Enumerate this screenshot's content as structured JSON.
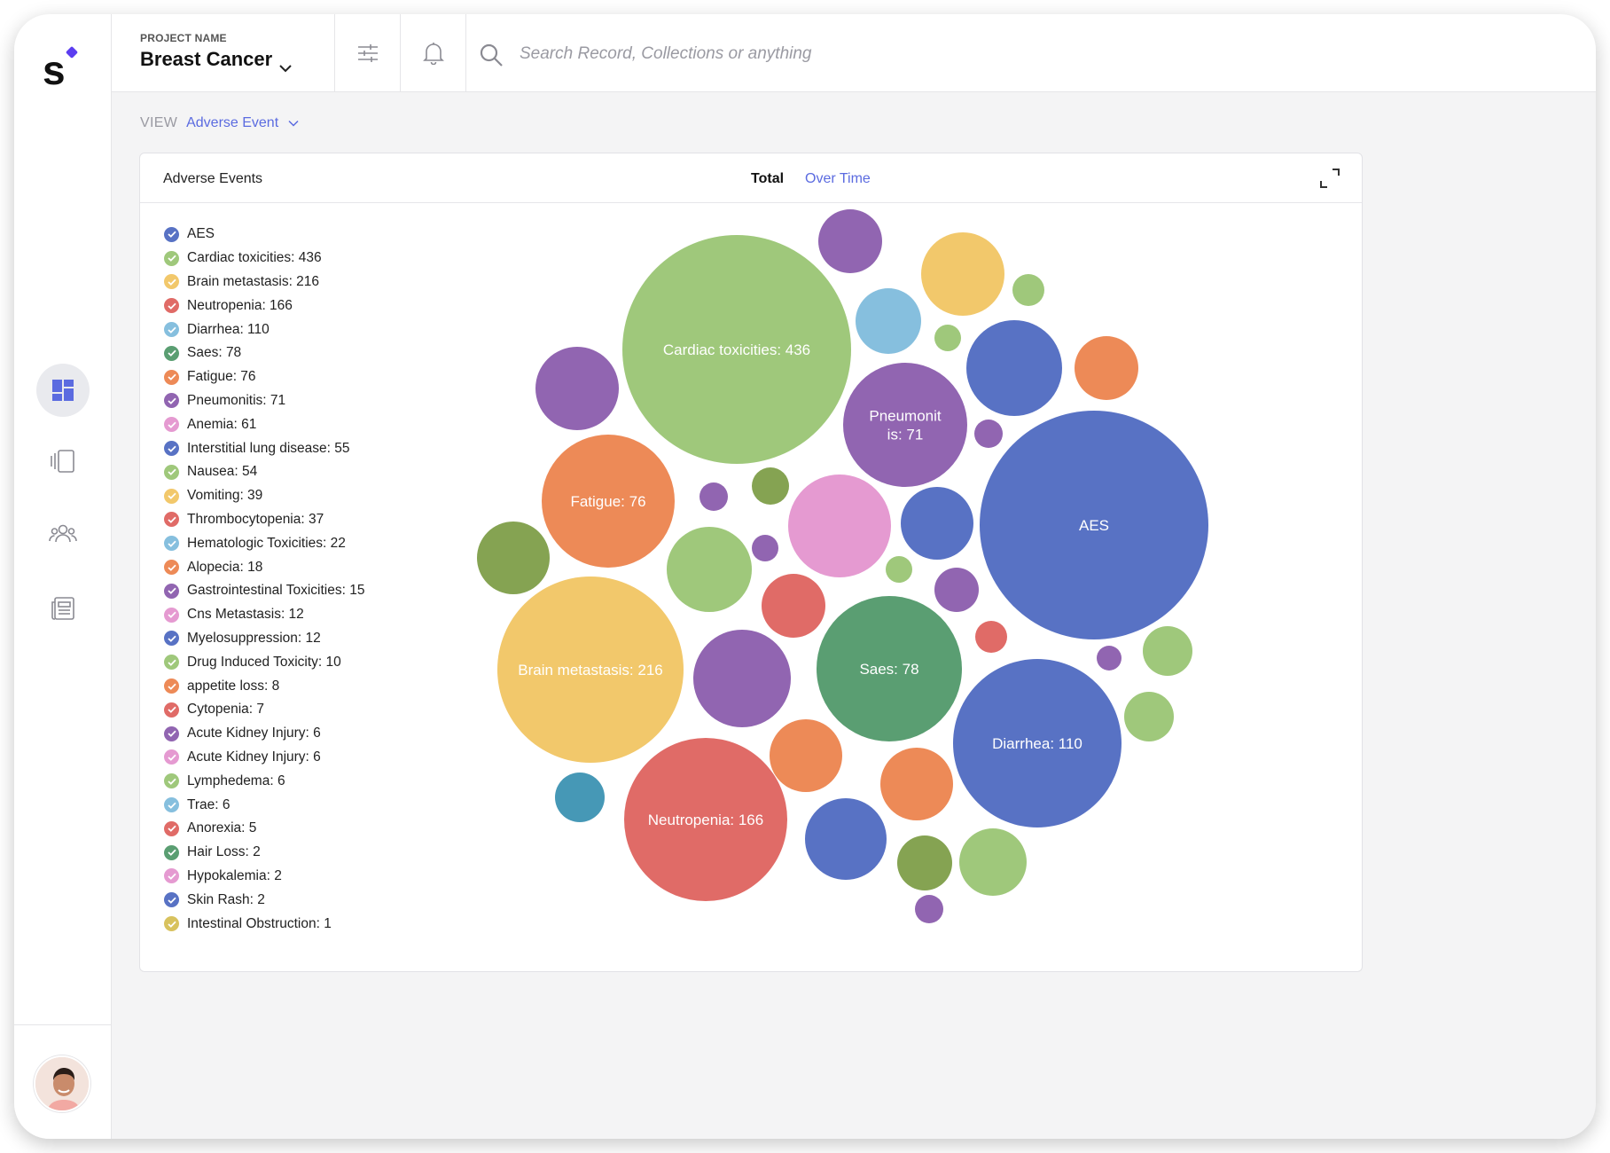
{
  "app": {
    "logo_text": "s"
  },
  "header": {
    "project_label": "PROJECT NAME",
    "project_name": "Breast Cancer",
    "search_placeholder": "Search Record, Collections or anything"
  },
  "view": {
    "label": "VIEW",
    "value": "Adverse Event"
  },
  "panel": {
    "title": "Adverse Events",
    "tabs": {
      "total": "Total",
      "over_time": "Over Time"
    },
    "active_tab": "Total"
  },
  "icons": {
    "sidebar": [
      "dashboard-icon",
      "collections-icon",
      "users-icon",
      "news-icon"
    ],
    "topbar": [
      "chevron-down-icon",
      "filter-sliders-icon",
      "bell-icon",
      "search-icon"
    ],
    "panel": [
      "expand-icon"
    ]
  },
  "colors": {
    "accent": "#5b6be0",
    "blue": "#5872c4",
    "green": "#9fc87b",
    "yellow": "#f2c86b",
    "red": "#e06b67",
    "lightblue": "#86bfde",
    "darkgreen": "#5a9e72",
    "orange": "#ed8a57",
    "purple": "#9165b1",
    "pink": "#e59ad1",
    "olive": "#85a352",
    "teal": "#4698b6",
    "mustard": "#d8c25e"
  },
  "legend": [
    {
      "label": "AES",
      "color": "#5872c4"
    },
    {
      "label": "Cardiac toxicities: 436",
      "color": "#9fc87b"
    },
    {
      "label": "Brain metastasis: 216",
      "color": "#f2c86b"
    },
    {
      "label": "Neutropenia: 166",
      "color": "#e06b67"
    },
    {
      "label": "Diarrhea: 110",
      "color": "#86bfde"
    },
    {
      "label": "Saes: 78",
      "color": "#5a9e72"
    },
    {
      "label": "Fatigue: 76",
      "color": "#ed8a57"
    },
    {
      "label": "Pneumonitis: 71",
      "color": "#9165b1"
    },
    {
      "label": "Anemia: 61",
      "color": "#e59ad1"
    },
    {
      "label": "Interstitial lung disease: 55",
      "color": "#5872c4"
    },
    {
      "label": "Nausea: 54",
      "color": "#9fc87b"
    },
    {
      "label": "Vomiting: 39",
      "color": "#f2c86b"
    },
    {
      "label": "Thrombocytopenia: 37",
      "color": "#e06b67"
    },
    {
      "label": "Hematologic Toxicities: 22",
      "color": "#86bfde"
    },
    {
      "label": "Alopecia: 18",
      "color": "#ed8a57"
    },
    {
      "label": "Gastrointestinal Toxicities: 15",
      "color": "#9165b1"
    },
    {
      "label": "Cns Metastasis: 12",
      "color": "#e59ad1"
    },
    {
      "label": "Myelosuppression: 12",
      "color": "#5872c4"
    },
    {
      "label": "Drug Induced Toxicity: 10",
      "color": "#9fc87b"
    },
    {
      "label": "appetite loss: 8",
      "color": "#ed8a57"
    },
    {
      "label": "Cytopenia: 7",
      "color": "#e06b67"
    },
    {
      "label": "Acute Kidney Injury: 6",
      "color": "#9165b1"
    },
    {
      "label": "Acute Kidney Injury: 6",
      "color": "#e59ad1"
    },
    {
      "label": "Lymphedema: 6",
      "color": "#9fc87b"
    },
    {
      "label": "Trae: 6",
      "color": "#86bfde"
    },
    {
      "label": "Anorexia: 5",
      "color": "#e06b67"
    },
    {
      "label": "Hair Loss: 2",
      "color": "#5a9e72"
    },
    {
      "label": "Hypokalemia: 2",
      "color": "#e59ad1"
    },
    {
      "label": "Skin Rash: 2",
      "color": "#5872c4"
    },
    {
      "label": "Intestinal Obstruction: 1",
      "color": "#d8c25e"
    }
  ],
  "chart_data": {
    "type": "bubble",
    "labeled_bubbles": [
      {
        "name": "AES",
        "label_lines": [
          "AES"
        ],
        "color": "#5872c4"
      },
      {
        "name": "Cardiac toxicities",
        "value": 436,
        "label_lines": [
          "Cardiac toxicities: 436"
        ],
        "color": "#9fc87b"
      },
      {
        "name": "Brain metastasis",
        "value": 216,
        "label_lines": [
          "Brain metastasis: 216"
        ],
        "color": "#f2c86b"
      },
      {
        "name": "Neutropenia",
        "value": 166,
        "label_lines": [
          "Neutropenia: 166"
        ],
        "color": "#e06b67"
      },
      {
        "name": "Diarrhea",
        "value": 110,
        "label_lines": [
          "Diarrhea: 110"
        ],
        "color": "#5872c4"
      },
      {
        "name": "Saes",
        "value": 78,
        "label_lines": [
          "Saes: 78"
        ],
        "color": "#5a9e72"
      },
      {
        "name": "Fatigue",
        "value": 76,
        "label_lines": [
          "Fatigue: 76"
        ],
        "color": "#ed8a57"
      },
      {
        "name": "Pneumonitis",
        "value": 71,
        "label_lines": [
          "Pneumonit",
          "is: 71"
        ],
        "color": "#9165b1"
      }
    ],
    "unlabeled_bubble_colors": [
      "#e59ad1",
      "#9165b1",
      "#9fc87b",
      "#ed8a57",
      "#9165b1",
      "#85a352",
      "#9fc87b",
      "#f2c86b",
      "#86bfde",
      "#5872c4",
      "#ed8a57",
      "#5872c4",
      "#e06b67",
      "#ed8a57",
      "#ed8a57",
      "#5872c4",
      "#85a352",
      "#9fc87b",
      "#9165b1",
      "#4698b6",
      "#9fc87b",
      "#9fc87b",
      "#9fc87b",
      "#9fc87b",
      "#85a352",
      "#9165b1",
      "#9165b1",
      "#9165b1",
      "#9165b1",
      "#9165b1",
      "#e06b67",
      "#9fc87b",
      "#9fc87b",
      "#9fc87b",
      "#9165b1"
    ]
  }
}
